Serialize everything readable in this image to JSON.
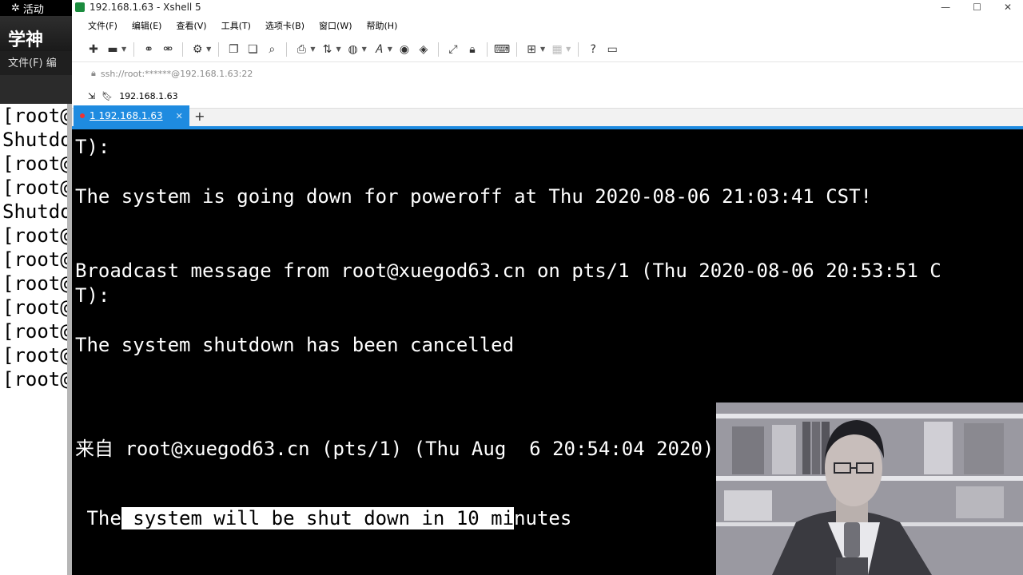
{
  "topbar": {
    "label": "活动"
  },
  "bg_window": {
    "title": "学神",
    "menu": "文件(F)  编",
    "lines": [
      "[root@",
      "Shutdo",
      "[root@",
      "[root@",
      "Shutdo",
      "[root@",
      "[root@",
      "[root@",
      "[root@",
      "[root@",
      "[root@",
      "[root@"
    ]
  },
  "xshell": {
    "title": "192.168.1.63 - Xshell 5",
    "menu": [
      "文件(F)",
      "编辑(E)",
      "查看(V)",
      "工具(T)",
      "选项卡(B)",
      "窗口(W)",
      "帮助(H)"
    ],
    "address": "ssh://root:******@192.168.1.63:22",
    "link": "192.168.1.63",
    "tab": "1 192.168.1.63",
    "newtab": "+"
  },
  "terminal": {
    "lines": [
      "T):",
      "The system is going down for poweroff at Thu 2020-08-06 21:03:41 CST!",
      "Broadcast message from root@xuegod63.cn on pts/1 (Thu 2020-08-06 20:53:51 C",
      "T):",
      "The system shutdown has been cancelled",
      "来自 root@xuegod63.cn (pts/1) (Thu Aug  6 20:54:04 2020):"
    ],
    "last": {
      "pre": " The",
      "selected": " system will be shut down in 10 mi",
      "post": "nutes"
    }
  },
  "colors": {
    "accent": "#1e8be0",
    "terminal_bg": "#000000",
    "terminal_fg": "#ffffff"
  }
}
